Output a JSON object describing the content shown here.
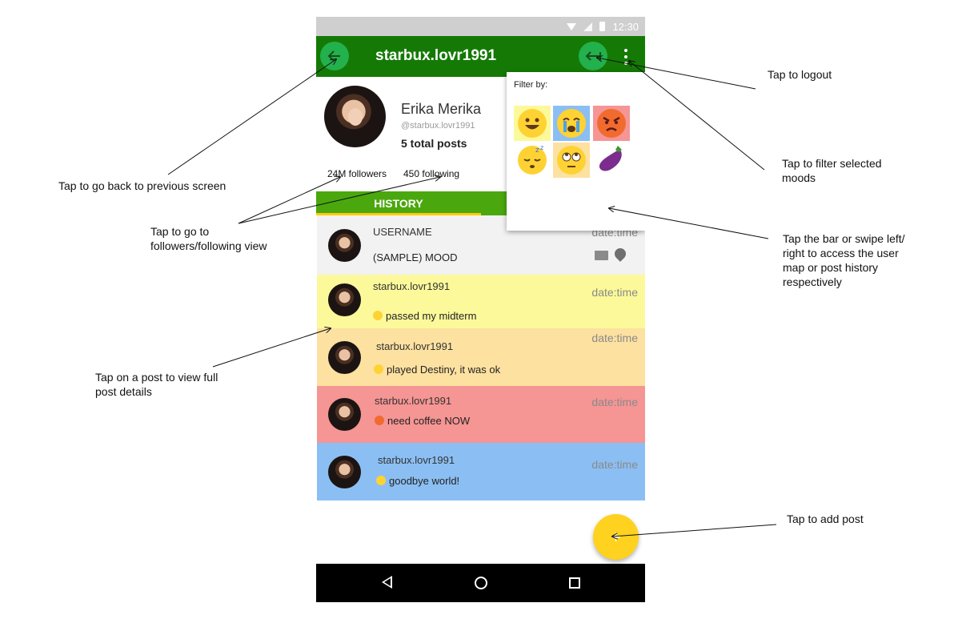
{
  "status_bar": {
    "time": "12:30"
  },
  "app_bar": {
    "title": "starbux.lovr1991"
  },
  "profile": {
    "name": "Erika Merika",
    "handle": "@starbux.lovr1991",
    "total_posts": "5 total posts",
    "followers": "24M followers",
    "following": "450 following"
  },
  "tabs": {
    "history": "HISTORY"
  },
  "filter": {
    "label": "Filter by:",
    "moods": [
      {
        "name": "happy",
        "bg": "#fcf99a",
        "face": "#ffd233"
      },
      {
        "name": "crying",
        "bg": "#8bbff3",
        "face": "#ffd233"
      },
      {
        "name": "angry",
        "bg": "#f59594",
        "face": "#f26b2e"
      },
      {
        "name": "sleepy",
        "bg": "#ffffff",
        "face": "#ffd233"
      },
      {
        "name": "eye-roll",
        "bg": "#fde1a0",
        "face": "#ffd233"
      },
      {
        "name": "eggplant",
        "bg": "#ffffff",
        "face": "#7b2d8e"
      }
    ]
  },
  "posts": [
    {
      "user": "USERNAME",
      "text": "(SAMPLE) MOOD",
      "date": "date:time",
      "bg": "#f2f2f2"
    },
    {
      "user": "starbux.lovr1991",
      "text": "passed my midterm",
      "date": "date:time",
      "bg": "#fcf99a",
      "emoji": "#ffd233"
    },
    {
      "user": "starbux.lovr1991",
      "text": "played Destiny, it was ok",
      "date": "date:time",
      "bg": "#fde1a0",
      "emoji": "#ffd233"
    },
    {
      "user": "starbux.lovr1991",
      "text": "need coffee NOW",
      "date": "date:time",
      "bg": "#f59594",
      "emoji": "#f26b2e"
    },
    {
      "user": "starbux.lovr1991",
      "text": "goodbye world!",
      "date": "date:time",
      "bg": "#8bbff3",
      "emoji": "#ffd233"
    }
  ],
  "fab": {
    "symbol": "+"
  },
  "annotations": {
    "back": "Tap to go back to previous screen",
    "followers": "Tap to go to followers/following view",
    "post": "Tap on a post to view full post details",
    "logout": "Tap to logout",
    "filter": "Tap to filter selected moods",
    "swipe": "Tap the bar or swipe left/ right to access the user map or post history respectively",
    "add": "Tap to add post"
  }
}
